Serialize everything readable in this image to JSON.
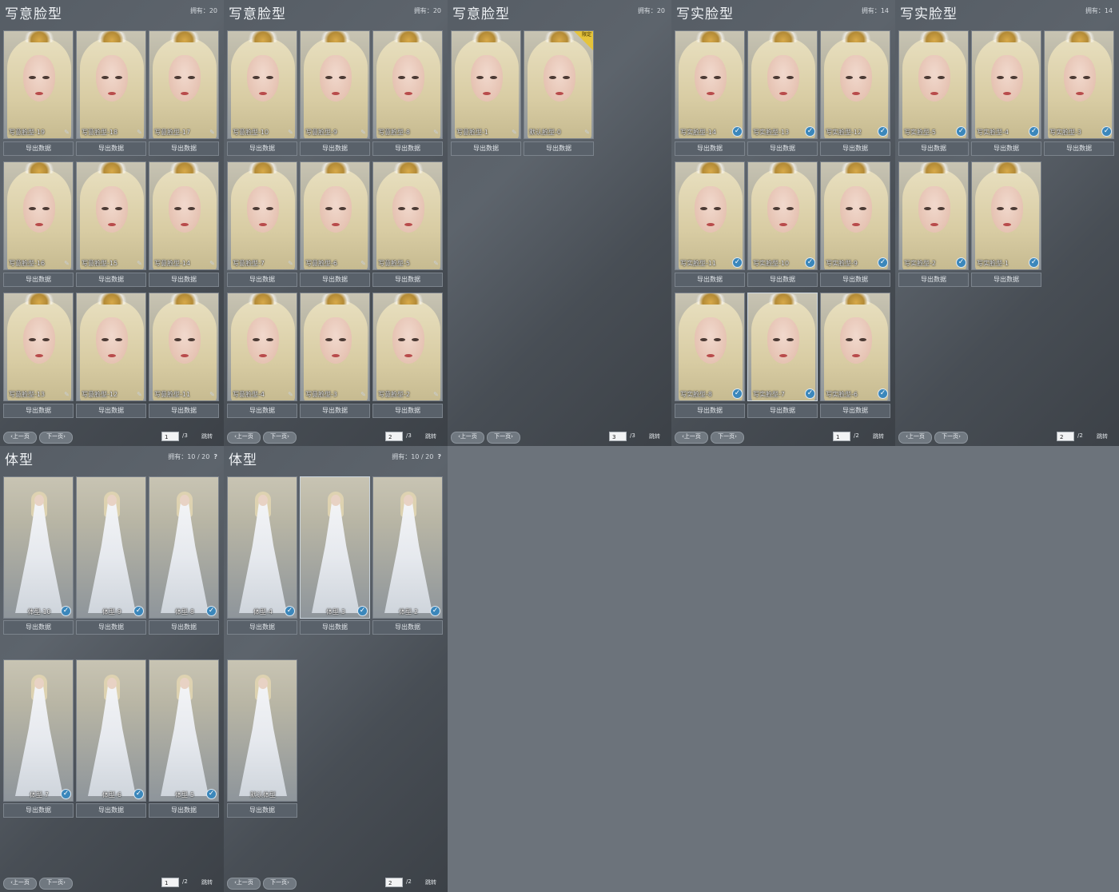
{
  "face_panels": [
    {
      "title": "写意脸型",
      "owned_label": "拥有：",
      "owned_count": "20",
      "page": "1",
      "total": "/3",
      "items": [
        "写意脸型-19",
        "写意脸型-18",
        "写意脸型-17",
        "写意脸型-16",
        "写意脸型-15",
        "写意脸型-14",
        "写意脸型-13",
        "写意脸型-12",
        "写意脸型-11"
      ]
    },
    {
      "title": "写意脸型",
      "owned_label": "拥有：",
      "owned_count": "20",
      "page": "2",
      "total": "/3",
      "items": [
        "写意脸型-10",
        "写意脸型-9",
        "写意脸型-8",
        "写意脸型-7",
        "写意脸型-6",
        "写意脸型-5",
        "写意脸型-4",
        "写意脸型-3",
        "写意脸型-2"
      ]
    },
    {
      "title": "写意脸型",
      "owned_label": "拥有：",
      "owned_count": "20",
      "page": "3",
      "total": "/3",
      "items": [
        "写意脸型-1",
        "默认脸型-0"
      ]
    },
    {
      "title": "写实脸型",
      "owned_label": "拥有：",
      "owned_count": "14",
      "page": "1",
      "total": "/2",
      "items": [
        "写实脸型-14",
        "写实脸型-13",
        "写实脸型-12",
        "写实脸型-11",
        "写实脸型-10",
        "写实脸型-9",
        "写实脸型-8",
        "写实脸型-7",
        "写实脸型-6"
      ]
    },
    {
      "title": "写实脸型",
      "owned_label": "拥有：",
      "owned_count": "14",
      "page": "2",
      "total": "/2",
      "items": [
        "写实脸型-5",
        "写实脸型-4",
        "写实脸型-3",
        "写实脸型-2",
        "写实脸型-1"
      ]
    }
  ],
  "body_panels": [
    {
      "title": "体型",
      "owned_label": "拥有：",
      "owned_count": "10 / 20",
      "help": "?",
      "page": "1",
      "total": "/2",
      "items": [
        "体型-10",
        "体型-9",
        "体型-8",
        "体型-7",
        "体型-6",
        "体型-5"
      ]
    },
    {
      "title": "体型",
      "owned_label": "拥有：",
      "owned_count": "10 / 20",
      "help": "?",
      "page": "2",
      "total": "/2",
      "items": [
        "体型-4",
        "体型-3",
        "体型-2",
        "默认体型"
      ]
    }
  ],
  "export_label": "导出数据",
  "prev_label": "上一页",
  "next_label": "下一页",
  "jump_label": "跳转",
  "tag_label": "限定"
}
